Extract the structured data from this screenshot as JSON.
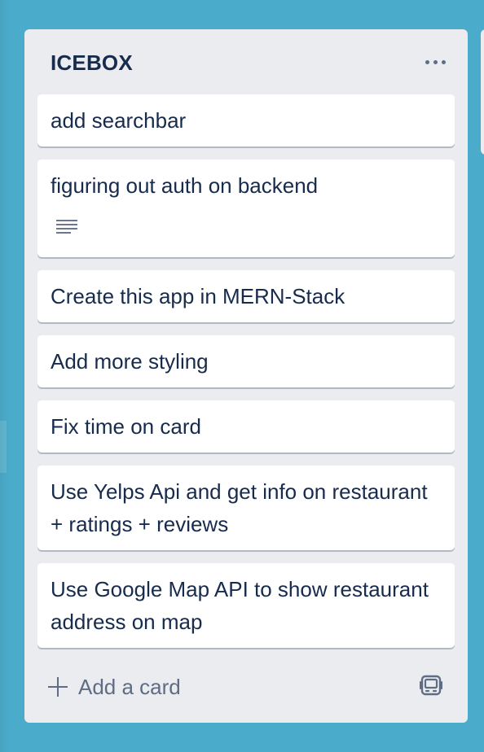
{
  "list": {
    "title": "ICEBOX",
    "menu_icon": "more-horizontal-icon",
    "cards": [
      {
        "text": "add searchbar"
      },
      {
        "text": "figuring out auth on backend",
        "badges": [
          "description-icon"
        ]
      },
      {
        "text": "Create this app in MERN-Stack"
      },
      {
        "text": "Add more styling"
      },
      {
        "text": "Fix time on card"
      },
      {
        "text": "Use Yelps Api and get info on restaurant + ratings + reviews"
      },
      {
        "text": "Use Google Map API to show restaurant address on map"
      }
    ],
    "add_card_label": "Add a card",
    "add_card_icon": "plus-icon",
    "template_icon": "card-template-icon"
  },
  "colors": {
    "board_background": "#4aacca",
    "list_background": "#ebecf0",
    "card_background": "#ffffff",
    "text_primary": "#172b4d",
    "text_secondary": "#5e6c84"
  }
}
